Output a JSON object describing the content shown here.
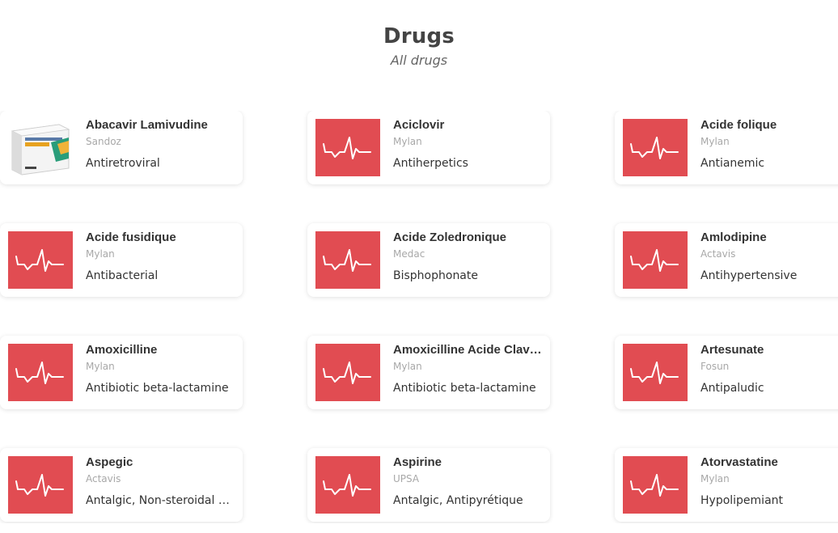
{
  "header": {
    "title": "Drugs",
    "subtitle": "All drugs"
  },
  "colors": {
    "thumb_bg": "#e14c52",
    "icon_stroke": "#ffffff"
  },
  "drugs": [
    {
      "name": "Abacavir Lamivudine",
      "lab": "Sandoz",
      "category": "Antiretroviral",
      "image": "product-box-photo"
    },
    {
      "name": "Aciclovir",
      "lab": "Mylan",
      "category": "Antiherpetics",
      "image": "heartbeat-icon"
    },
    {
      "name": "Acide folique",
      "lab": "Mylan",
      "category": "Antianemic",
      "image": "heartbeat-icon"
    },
    {
      "name": "Acide fusidique",
      "lab": "Mylan",
      "category": "Antibacterial",
      "image": "heartbeat-icon"
    },
    {
      "name": "Acide Zoledronique",
      "lab": "Medac",
      "category": "Bisphophonate",
      "image": "heartbeat-icon"
    },
    {
      "name": "Amlodipine",
      "lab": "Actavis",
      "category": "Antihypertensive",
      "image": "heartbeat-icon"
    },
    {
      "name": "Amoxicilline",
      "lab": "Mylan",
      "category": "Antibiotic beta-lactamine",
      "image": "heartbeat-icon"
    },
    {
      "name": "Amoxicilline Acide Clavulanique",
      "lab": "Mylan",
      "category": "Antibiotic beta-lactamine",
      "image": "heartbeat-icon"
    },
    {
      "name": "Artesunate",
      "lab": "Fosun",
      "category": "Antipaludic",
      "image": "heartbeat-icon"
    },
    {
      "name": "Aspegic",
      "lab": "Actavis",
      "category": "Antalgic, Non-steroidal anti-inflammatory",
      "image": "heartbeat-icon"
    },
    {
      "name": "Aspirine",
      "lab": "UPSA",
      "category": "Antalgic, Antipyrétique",
      "image": "heartbeat-icon"
    },
    {
      "name": "Atorvastatine",
      "lab": "Mylan",
      "category": "Hypolipemiant",
      "image": "heartbeat-icon"
    }
  ]
}
